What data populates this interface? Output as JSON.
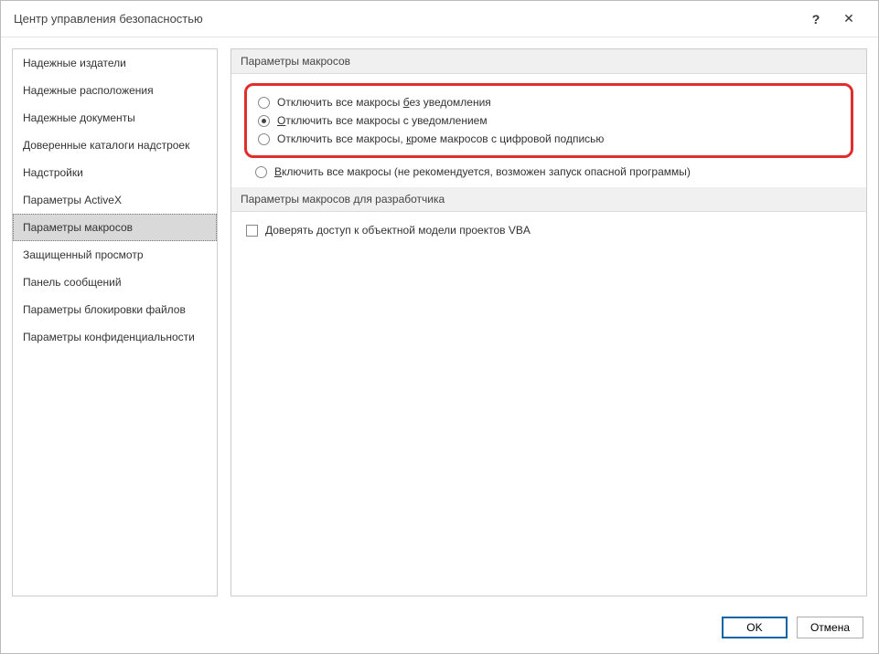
{
  "title": "Центр управления безопасностью",
  "help": "?",
  "close": "✕",
  "sidebar": {
    "items": [
      {
        "label": "Надежные издатели"
      },
      {
        "label": "Надежные расположения"
      },
      {
        "label": "Надежные документы"
      },
      {
        "label": "Доверенные каталоги надстроек"
      },
      {
        "label": "Надстройки"
      },
      {
        "label": "Параметры ActiveX"
      },
      {
        "label": "Параметры макросов"
      },
      {
        "label": "Защищенный просмотр"
      },
      {
        "label": "Панель сообщений"
      },
      {
        "label": "Параметры блокировки файлов"
      },
      {
        "label": "Параметры конфиденциальности"
      }
    ]
  },
  "sections": {
    "macros_header": "Параметры макросов",
    "developer_header": "Параметры макросов для разработчика"
  },
  "options": {
    "r1a": "Отключить все макросы ",
    "r1b": "б",
    "r1c": "ез уведомления",
    "r2a": "О",
    "r2b": "тключить все макросы с уведомлением",
    "r3a": "Отключить все макросы, ",
    "r3b": "к",
    "r3c": "роме макросов с цифровой подписью",
    "r4a": "В",
    "r4b": "ключить все макросы (не рекомендуется, возможен запуск опасной программы)",
    "c1": "Доверять доступ к объектной модели проектов VBA"
  },
  "buttons": {
    "ok": "OK",
    "cancel": "Отмена"
  }
}
